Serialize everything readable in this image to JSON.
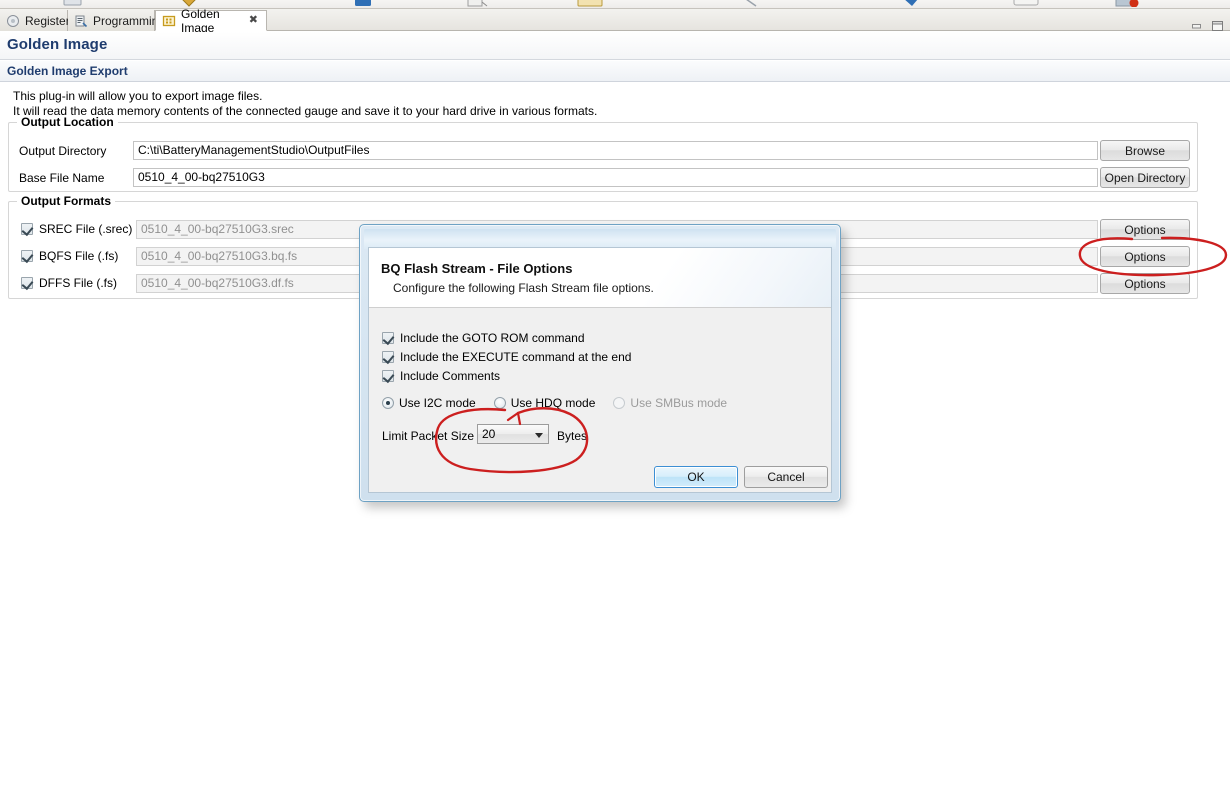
{
  "window": {
    "minimize_icon": "minimize-icon",
    "maximize_icon": "maximize-icon"
  },
  "tabs": [
    {
      "label": "Registers",
      "icon": "registers-icon",
      "active": false,
      "closable": false
    },
    {
      "label": "Programming",
      "icon": "programming-icon",
      "active": false,
      "closable": false
    },
    {
      "label": "Golden Image",
      "icon": "golden-image-icon",
      "active": true,
      "closable": true,
      "close_glyph": "✖"
    }
  ],
  "page": {
    "title": "Golden Image",
    "section_title": "Golden Image Export",
    "intro_line1": "This plug-in will allow you to export image files.",
    "intro_line2": "It will read the data memory contents of the connected gauge and save it to your hard drive in various formats."
  },
  "output_location": {
    "legend": "Output Location",
    "fields": [
      {
        "label": "Output Directory",
        "value": "C:\\ti\\BatteryManagementStudio\\OutputFiles",
        "button": "Browse"
      },
      {
        "label": "Base File Name",
        "value": "0510_4_00-bq27510G3",
        "button": "Open Directory"
      }
    ]
  },
  "output_formats": {
    "legend": "Output Formats",
    "rows": [
      {
        "label": "SREC File (.srec)",
        "checked": true,
        "value": "0510_4_00-bq27510G3.srec",
        "button": "Options"
      },
      {
        "label": "BQFS File (.fs)",
        "checked": true,
        "value": "0510_4_00-bq27510G3.bq.fs",
        "button": "Options"
      },
      {
        "label": "DFFS File (.fs)",
        "checked": true,
        "value": "0510_4_00-bq27510G3.df.fs",
        "button": "Options"
      }
    ]
  },
  "dialog": {
    "title": "BQ Flash Stream  -  File Options",
    "subtitle": "Configure the following Flash Stream file options.",
    "checkboxes": [
      {
        "label": "Include the GOTO ROM command",
        "checked": true
      },
      {
        "label": "Include the EXECUTE command at the end",
        "checked": true
      },
      {
        "label": "Include Comments",
        "checked": true
      }
    ],
    "modes": [
      {
        "label": "Use I2C mode",
        "selected": true,
        "disabled": false
      },
      {
        "label": "Use HDQ mode",
        "selected": false,
        "disabled": false
      },
      {
        "label": "Use SMBus mode",
        "selected": false,
        "disabled": true
      }
    ],
    "packet": {
      "label": "Limit Packet Size",
      "value": "20",
      "unit": "Bytes"
    },
    "ok_label": "OK",
    "cancel_label": "Cancel"
  },
  "annotations": {
    "color": "#cc1f1f",
    "items": [
      {
        "name": "options-button-highlight",
        "shape": "ellipse"
      },
      {
        "name": "packet-size-highlight",
        "shape": "ellipse-with-arrow"
      }
    ]
  }
}
